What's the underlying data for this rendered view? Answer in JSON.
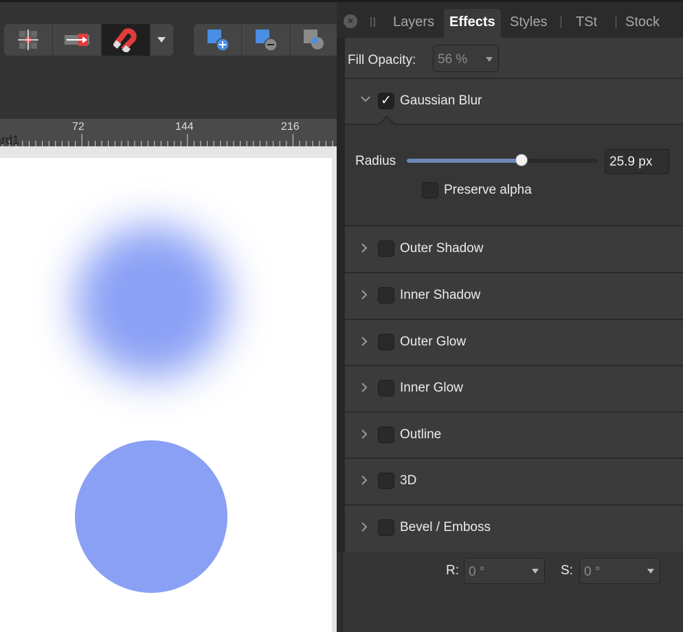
{
  "toolbar": {
    "groups": [
      {
        "items": [
          {
            "icon": "snapping-grid-icon"
          },
          {
            "icon": "snap-arrow-icon"
          },
          {
            "icon": "magnet-icon",
            "active": true
          },
          {
            "icon": "chevron-down-icon"
          }
        ]
      },
      {
        "items": [
          {
            "icon": "boolean-add-icon"
          },
          {
            "icon": "boolean-subtract-icon"
          },
          {
            "icon": "boolean-intersect-icon"
          }
        ]
      }
    ]
  },
  "ruler": {
    "labels": [
      "72",
      "144",
      "216"
    ],
    "artboard_name": "oard1"
  },
  "canvas": {
    "shape_color": "#8aa0f5"
  },
  "panel": {
    "tabs": [
      {
        "label": "Layers",
        "active": false
      },
      {
        "label": "Effects",
        "active": true
      },
      {
        "label": "Styles",
        "active": false
      },
      {
        "label": "TSt",
        "active": false
      },
      {
        "label": "Stock",
        "active": false
      }
    ],
    "fill_opacity": {
      "label": "Fill Opacity:",
      "value": "56 %"
    },
    "gaussian_blur": {
      "label": "Gaussian Blur",
      "checked": true,
      "radius_label": "Radius",
      "radius_value": "25.9 px",
      "radius_fraction": 0.6,
      "preserve_alpha_label": "Preserve alpha",
      "preserve_alpha": false
    },
    "effects": [
      {
        "label": "Outer Shadow",
        "checked": false
      },
      {
        "label": "Inner Shadow",
        "checked": false
      },
      {
        "label": "Outer Glow",
        "checked": false
      },
      {
        "label": "Inner Glow",
        "checked": false
      },
      {
        "label": "Outline",
        "checked": false
      },
      {
        "label": "3D",
        "checked": false
      },
      {
        "label": "Bevel / Emboss",
        "checked": false
      }
    ],
    "rotation": {
      "r_label": "R:",
      "r_value": "0 °",
      "s_label": "S:",
      "s_value": "0 °"
    }
  }
}
